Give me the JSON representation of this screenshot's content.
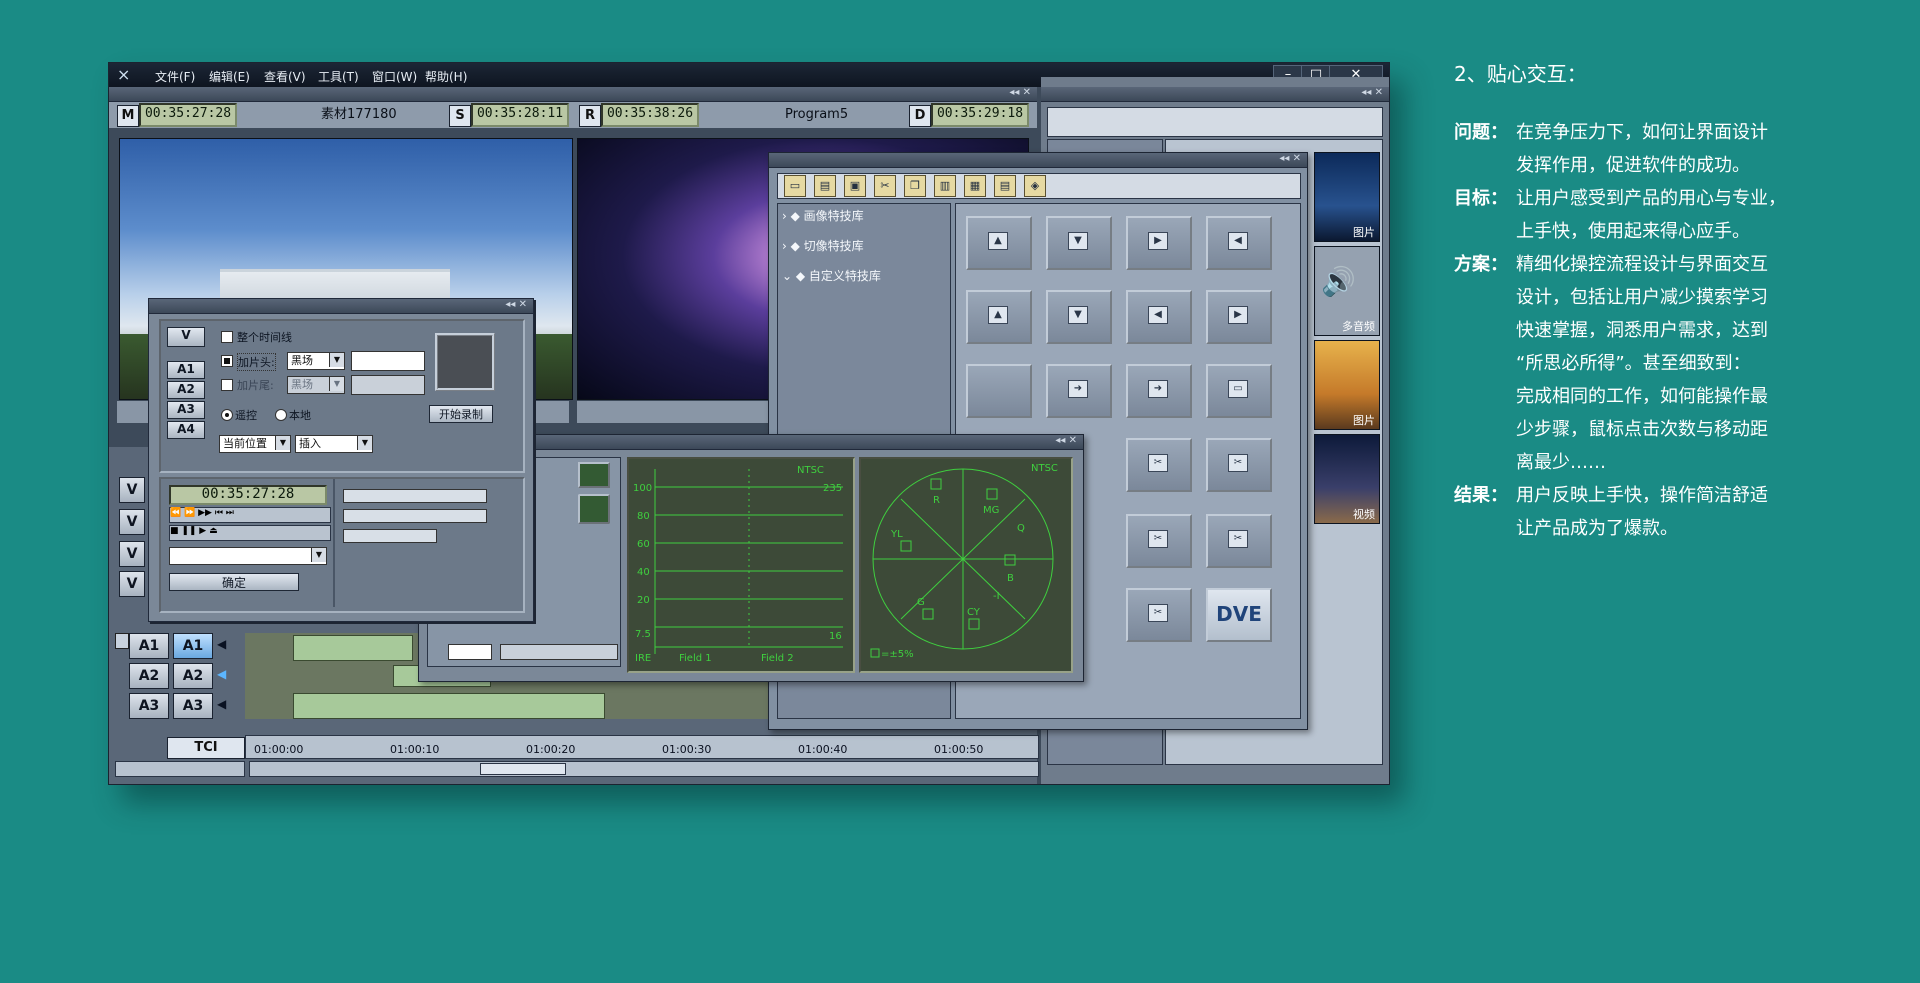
{
  "app": {
    "menu": [
      "文件(F)",
      "编辑(E)",
      "查看(V)",
      "工具(T)",
      "窗口(W)",
      "帮助(H)"
    ],
    "window_controls": [
      "–",
      "□",
      "✕"
    ],
    "header": {
      "m_label": "M",
      "m_tc": "00:35:27:28",
      "clip_name": "素材177180",
      "s_label": "S",
      "s_tc": "00:35:28:11",
      "r_label": "R",
      "r_tc": "00:35:38:26",
      "program_name": "Program5",
      "d_label": "D",
      "d_tc": "00:35:29:18"
    },
    "record_dialog": {
      "v_btn": "V",
      "a_btns": [
        "A1",
        "A2",
        "A3",
        "A4"
      ],
      "whole_timeline": "整个时间线",
      "add_head": "加片头:",
      "add_head_value": "黑场",
      "add_tail": "加片尾:",
      "add_tail_value": "黑场",
      "start_record": "开始录制",
      "remote": "遥控",
      "local": "本地",
      "position": "当前位置",
      "mode": "插入",
      "timecode": "00:35:27:28",
      "ok": "确定"
    },
    "effects_panel": {
      "tree": [
        "画像特技库",
        "切像特技库",
        "自定义特技库"
      ],
      "dve_label": "DVE"
    },
    "scope": {
      "wave_labels": [
        "100",
        "80",
        "60",
        "40",
        "20",
        "7.5"
      ],
      "ntsc": "NTSC",
      "v235": "235",
      "v16": "16",
      "ire": "IRE",
      "field1": "Field 1",
      "field2": "Field 2",
      "vec_ntsc": "NTSC",
      "vec_labels": [
        "R",
        "MG",
        "B",
        "YL",
        "G",
        "CY",
        "Q",
        "-I"
      ],
      "vec_note": "=±5%"
    },
    "tracks": {
      "v_labels": [
        "V",
        "V",
        "V",
        "V"
      ],
      "a_labels": [
        "A1",
        "A2",
        "A3"
      ],
      "tc_label": "TCI",
      "ruler": [
        "01:00:00",
        "01:00:10",
        "01:00:20",
        "01:00:30",
        "01:00:40",
        "01:00:50"
      ]
    },
    "thumbs": [
      {
        "label": "图片"
      },
      {
        "label": "多音频"
      },
      {
        "label": "图片"
      },
      {
        "label": "视频"
      }
    ]
  },
  "right_text": {
    "title": "2、贴心交互：",
    "items": [
      {
        "key": "问题：",
        "lines": [
          "在竞争压力下，如何让界面设计",
          "发挥作用，促进软件的成功。"
        ]
      },
      {
        "key": "目标：",
        "lines": [
          "让用户感受到产品的用心与专业，",
          "上手快，使用起来得心应手。"
        ]
      },
      {
        "key": "方案：",
        "lines": [
          "精细化操控流程设计与界面交互",
          "设计，包括让用户减少摸索学习",
          "快速掌握，洞悉用户需求，达到",
          "“所思必所得”。甚至细致到：",
          "完成相同的工作，如何能操作最",
          "少步骤，鼠标点击次数与移动距",
          "离最少……"
        ]
      },
      {
        "key": "结果：",
        "lines": [
          "用户反映上手快，操作简洁舒适",
          "让产品成为了爆款。"
        ]
      }
    ]
  },
  "colors": {
    "background": "#1a8b85",
    "window": "#3d4a5a",
    "scope_green": "#3fcf3f"
  }
}
